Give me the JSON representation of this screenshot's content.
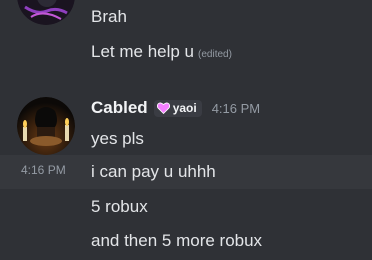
{
  "messages_prev": [
    {
      "text": "Brah"
    },
    {
      "text": "Let me help u",
      "edited_label": "(edited)"
    }
  ],
  "group": {
    "username": "Cabled",
    "tag_label": "yaoi",
    "tag_icon": "heart-icon",
    "timestamp": "4:16 PM",
    "messages": [
      {
        "text": "yes pls"
      },
      {
        "text": "i can pay u uhhh",
        "hover_timestamp": "4:16 PM"
      },
      {
        "text": "5 robux"
      },
      {
        "text": "and then 5 more robux"
      }
    ]
  },
  "colors": {
    "background": "#2f3136",
    "hover_row": "#36383d",
    "text": "#e3e5e8",
    "muted": "#949ba4",
    "tag_heart": "#f47fff"
  }
}
